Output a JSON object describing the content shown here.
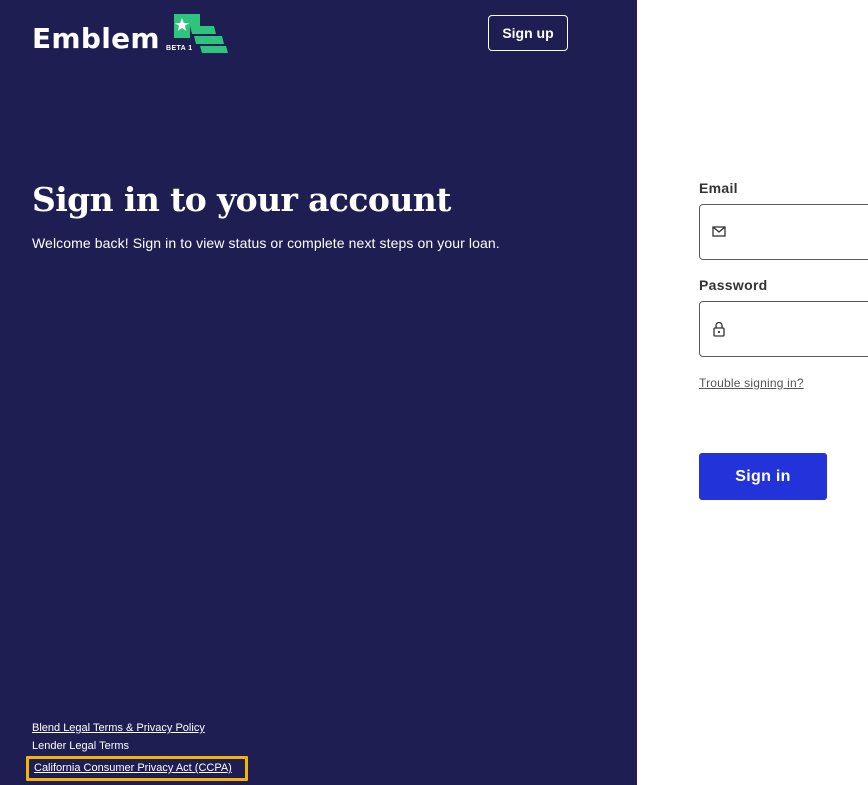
{
  "brand": {
    "name": "Emblem",
    "badge": "BETA 1",
    "colors": {
      "panel": "#1e1e52",
      "flag": "#2ec47e",
      "accent": "#2233d9",
      "highlight": "#f5b400"
    }
  },
  "header": {
    "signup_label": "Sign up"
  },
  "hero": {
    "title": "Sign in to your account",
    "subtitle": "Welcome back! Sign in to view status or complete next steps on your loan."
  },
  "footer": {
    "links": [
      "Blend Legal Terms & Privacy Policy",
      "Lender Legal Terms",
      "California Consumer Privacy Act (CCPA)"
    ]
  },
  "form": {
    "email_label": "Email",
    "email_icon": "envelope-icon",
    "email_value": "",
    "password_label": "Password",
    "password_icon": "lock-icon",
    "password_value": "",
    "trouble_link": "Trouble signing in?",
    "submit_label": "Sign in"
  }
}
